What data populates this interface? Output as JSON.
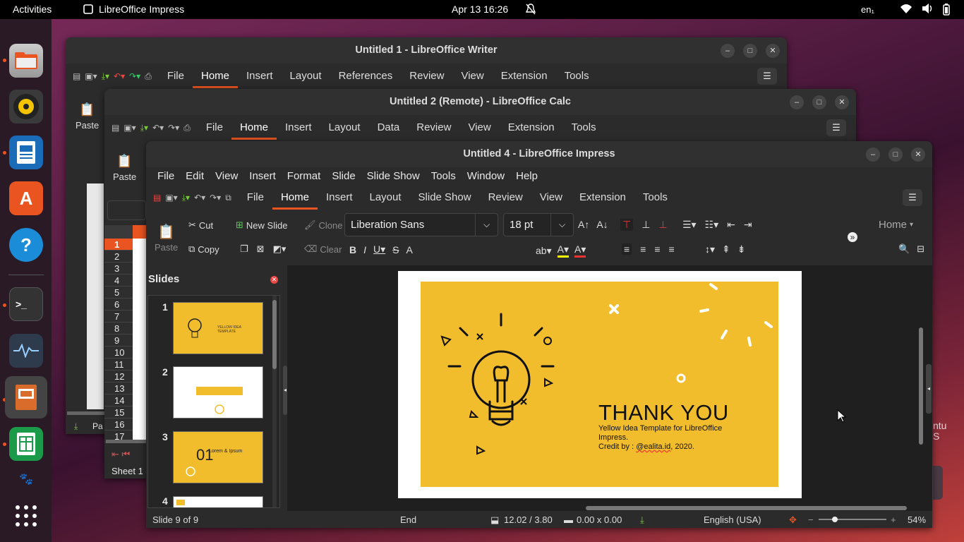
{
  "topbar": {
    "activities": "Activities",
    "app_name": "LibreOffice Impress",
    "clock": "Apr 13  16:26",
    "lang": "en₁"
  },
  "dock": {
    "items": [
      "files-icon",
      "rhythmbox-icon",
      "writer-icon",
      "app-center-icon",
      "help-icon",
      "terminal-icon",
      "system-monitor-icon",
      "impress-icon",
      "calc-icon",
      "gimp-icon",
      "show-apps-icon"
    ]
  },
  "writer": {
    "title": "Untitled 1 - LibreOffice Writer",
    "tabs": [
      "File",
      "Home",
      "Insert",
      "Layout",
      "References",
      "Review",
      "View",
      "Extension",
      "Tools"
    ],
    "paste": "Paste"
  },
  "calc": {
    "title": "Untitled 2 (Remote) - LibreOffice Calc",
    "tabs": [
      "File",
      "Home",
      "Insert",
      "Layout",
      "Data",
      "Review",
      "View",
      "Extension",
      "Tools"
    ],
    "paste": "Paste",
    "rows": [
      "1",
      "2",
      "3",
      "4",
      "5",
      "6",
      "7",
      "8",
      "9",
      "10",
      "11",
      "12",
      "13",
      "14",
      "15",
      "16",
      "17"
    ],
    "sheet": "Sheet 1 o",
    "status_pa": "Pa"
  },
  "impress": {
    "title": "Untitled 4 - LibreOffice Impress",
    "menu": [
      "File",
      "Edit",
      "View",
      "Insert",
      "Format",
      "Slide",
      "Slide Show",
      "Tools",
      "Window",
      "Help"
    ],
    "tabs": [
      "File",
      "Home",
      "Insert",
      "Layout",
      "Slide Show",
      "Review",
      "View",
      "Extension",
      "Tools"
    ],
    "toolbar": {
      "cut": "Cut",
      "copy": "Copy",
      "paste": "Paste",
      "new_slide": "New Slide",
      "clone": "Clone",
      "clear": "Clear",
      "font_name": "Liberation Sans",
      "font_size": "18 pt",
      "home_dropdown": "Home"
    },
    "slides_panel": {
      "title": "Slides",
      "numbers": [
        "1",
        "2",
        "3",
        "4"
      ],
      "thumb1_text": "YELLOW IDEA TEMPLATE",
      "thumb3_num": "01",
      "thumb3_text": "Lorem & Ipsum"
    },
    "slide": {
      "heading": "THANK YOU",
      "line1": "Yellow Idea Template for LibreOffice",
      "line2": "Impress.",
      "credit_prefix": "Credit by : ",
      "credit_handle": "@ealita.id",
      "credit_suffix": ", 2020."
    },
    "status": {
      "slide": "Slide 9 of 9",
      "mode": "End",
      "position": "12.02 / 3.80",
      "size": "0.00 x 0.00",
      "language": "English (USA)",
      "zoom": "54%"
    }
  },
  "colors": {
    "accent": "#e95420",
    "slide_yellow": "#f2bd2c",
    "slide_white": "#ffffff"
  },
  "desktop_text": "ntu\nS"
}
